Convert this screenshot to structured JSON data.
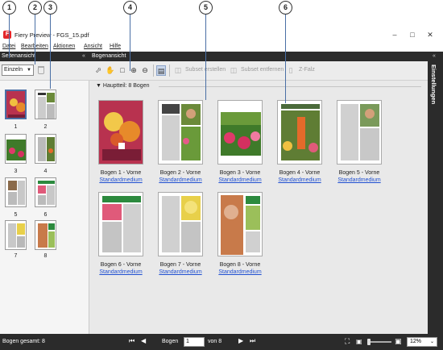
{
  "callouts": [
    "1",
    "2",
    "3",
    "4",
    "5",
    "6"
  ],
  "window": {
    "title": "Fiery Preview - FGS_15.pdf",
    "app_icon": "fiery-logo-icon"
  },
  "menu": [
    "Datei",
    "Bearbeiten",
    "Aktionen",
    "Ansicht",
    "Hilfe"
  ],
  "left_panel": {
    "header": "Seitenansicht",
    "view_select": "Einzeln",
    "thumbs": [
      "1",
      "2",
      "3",
      "4",
      "5",
      "6",
      "7",
      "8"
    ]
  },
  "main": {
    "header": "Bogenansicht",
    "toolbar": {
      "create_subset": "Subset erstellen",
      "remove_subset": "Subset entfernen",
      "zfold": "Z-Falz"
    },
    "section": "Hauptteil: 8 Bogen",
    "cards": [
      {
        "label": "Bogen 1 - Vorne",
        "media": "Standardmedium"
      },
      {
        "label": "Bogen 2 - Vorne",
        "media": "Standardmedium"
      },
      {
        "label": "Bogen 3 - Vorne",
        "media": "Standardmedium"
      },
      {
        "label": "Bogen 4 - Vorne",
        "media": "Standardmedium"
      },
      {
        "label": "Bogen 5 - Vorne",
        "media": "Standardmedium"
      },
      {
        "label": "Bogen 6 - Vorne",
        "media": "Standardmedium"
      },
      {
        "label": "Bogen 7 - Vorne",
        "media": "Standardmedium"
      },
      {
        "label": "Bogen 8 - Vorne",
        "media": "Standardmedium"
      }
    ]
  },
  "right_panel": {
    "label": "Einstellungen"
  },
  "status": {
    "total": "Bogen gesamt: 8",
    "page_label": "Bogen",
    "page_value": "1",
    "page_of": "von 8",
    "zoom": "12%"
  },
  "colors": {
    "accent": "#4a6fa5",
    "dark": "#2b2b2b",
    "link": "#1f4fd1"
  }
}
